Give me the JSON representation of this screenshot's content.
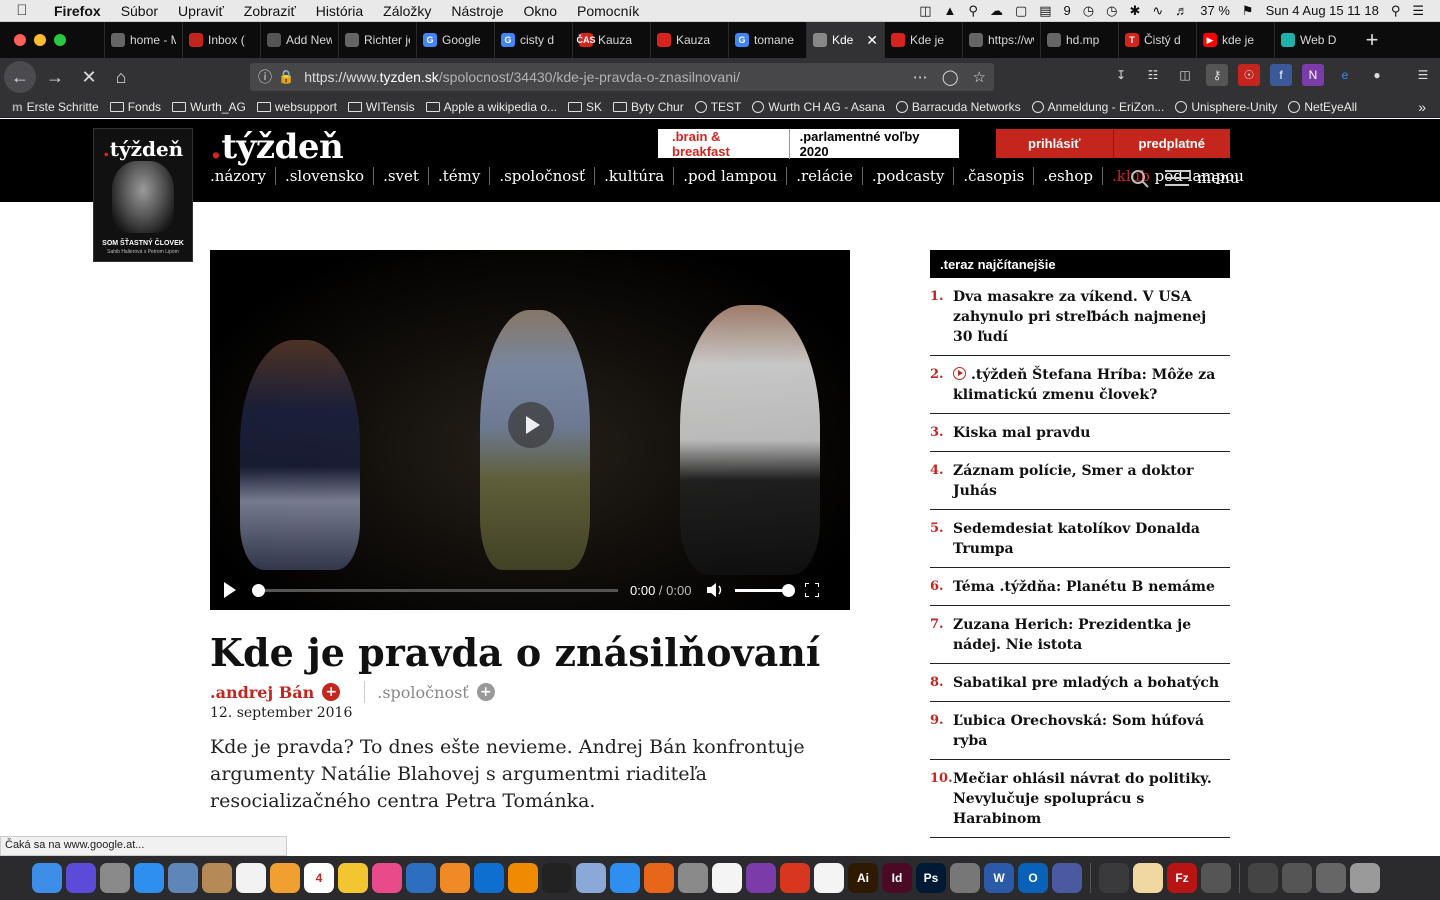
{
  "menubar": {
    "app": "Firefox",
    "items": [
      "Súbor",
      "Upraviť",
      "Zobraziť",
      "História",
      "Záložky",
      "Nástroje",
      "Okno",
      "Pomocník"
    ],
    "status": {
      "count": "9",
      "battery": "37 %",
      "datetime": "Sun 4 Aug  15 11 18"
    }
  },
  "tabs": [
    {
      "label": "home - Ma",
      "favicon_color": "#666666",
      "favicon_text": ""
    },
    {
      "label": "Inbox (",
      "favicon_color": "#c4261d",
      "favicon_text": ""
    },
    {
      "label": "Add New P",
      "favicon_color": "#555555",
      "favicon_text": ""
    },
    {
      "label": "Richter je z",
      "favicon_color": "#666666",
      "favicon_text": ""
    },
    {
      "label": "Google",
      "favicon_color": "#4285f4",
      "favicon_text": "G"
    },
    {
      "label": "cisty d",
      "favicon_color": "#4285f4",
      "favicon_text": "G"
    },
    {
      "label": "Kauza",
      "favicon_color": "#d7231e",
      "favicon_text": "ČAS"
    },
    {
      "label": "Kauza",
      "favicon_color": "#d7231e",
      "favicon_text": ""
    },
    {
      "label": "tomane",
      "favicon_color": "#4285f4",
      "favicon_text": "G"
    },
    {
      "label": "Kde",
      "favicon_color": "#888888",
      "favicon_text": "",
      "active": true
    },
    {
      "label": "Kde je",
      "favicon_color": "#d7231e",
      "favicon_text": ""
    },
    {
      "label": "https://ww",
      "favicon_color": "#666666",
      "favicon_text": ""
    },
    {
      "label": "hd.mp",
      "favicon_color": "#666666",
      "favicon_text": ""
    },
    {
      "label": "Čistý d",
      "favicon_color": "#d7231e",
      "favicon_text": "T"
    },
    {
      "label": "kde je",
      "favicon_color": "#ff0000",
      "favicon_text": "▶"
    },
    {
      "label": "Web D",
      "favicon_color": "#20b2aa",
      "favicon_text": ""
    }
  ],
  "urlbar": {
    "scheme": "https://www.",
    "host": "tyzden.sk",
    "path": "/spolocnost/34430/kde-je-pravda-o-znasilnovani/"
  },
  "bookmarks": [
    {
      "label": "Erste Schritte",
      "type": "m"
    },
    {
      "label": "Fonds",
      "type": "folder"
    },
    {
      "label": "Wurth_AG",
      "type": "folder"
    },
    {
      "label": "websupport",
      "type": "folder"
    },
    {
      "label": "WITensis",
      "type": "folder"
    },
    {
      "label": "Apple a wikipedia o...",
      "type": "folder"
    },
    {
      "label": "SK",
      "type": "folder"
    },
    {
      "label": "Byty Chur",
      "type": "folder"
    },
    {
      "label": "TEST",
      "type": "globe"
    },
    {
      "label": "Wurth CH AG - Asana",
      "type": "globe"
    },
    {
      "label": "Barracuda Networks",
      "type": "globe"
    },
    {
      "label": "Anmeldung - EriZon...",
      "type": "globe"
    },
    {
      "label": "Unisphere-Unity",
      "type": "globe"
    },
    {
      "label": "NetEyeAll",
      "type": "globe"
    }
  ],
  "site": {
    "logo_dot": ".",
    "logo_text": "týždeň",
    "nav": [
      ".názory",
      ".slovensko",
      ".svet",
      ".témy",
      ".spoločnosť",
      ".kultúra",
      ".pod lampou",
      ".relácie",
      ".podcasty",
      ".časopis",
      ".eshop"
    ],
    "nav_klub_red": ".klub",
    "nav_klub_rest": " pod lampou",
    "promo_1": ".brain & breakfast",
    "promo_2": ".parlamentné voľby 2020",
    "login": "prihlásiť",
    "subscribe": "predplatné",
    "menu": "menu"
  },
  "cover": {
    "title_dot": ".",
    "title": "týždeň",
    "caption": "SOM ŠŤASTNÝ ČLOVEK",
    "subcaption": "Sahib Hallerová s Petrom Lipom"
  },
  "video": {
    "time_current": "0:00",
    "time_sep": " / ",
    "time_total": "0:00",
    "progress": 0,
    "volume": 1.0
  },
  "article": {
    "title": "Kde je pravda o znásilňovaní",
    "author": ".andrej Bán",
    "section": ".spoločnosť",
    "date": "12. september 2016",
    "perex": "Kde je pravda? To dnes ešte nevieme. Andrej Bán konfrontuje argumenty Natálie Blahovej s argumentmi riaditeľa resocializačného centra Petra Tománka."
  },
  "most_read": {
    "header": ".teraz najčítanejšie",
    "items": [
      {
        "num": "1.",
        "title": "Dva masakre za víkend. V USA zahynulo pri streľbách najmenej 30 ľudí",
        "video": false
      },
      {
        "num": "2.",
        "title": ".týždeň Štefana Hríba: Môže za klimatickú zmenu človek?",
        "video": true
      },
      {
        "num": "3.",
        "title": "Kiska mal pravdu",
        "video": false
      },
      {
        "num": "4.",
        "title": "Záznam polície, Smer a doktor Juhás",
        "video": false
      },
      {
        "num": "5.",
        "title": "Sedemdesiat katolíkov Donalda Trumpa",
        "video": false
      },
      {
        "num": "6.",
        "title": "Téma .týždňa: Planétu B nemáme",
        "video": false
      },
      {
        "num": "7.",
        "title": "Zuzana Herich: Prezidentka je nádej. Nie istota",
        "video": false
      },
      {
        "num": "8.",
        "title": "Sabatikal pre mladých a bohatých",
        "video": false
      },
      {
        "num": "9.",
        "title": "Ľubica Orechovská: Som húfová ryba",
        "video": false
      },
      {
        "num": "10.",
        "title": "Mečiar ohlásil návrat do politiky. Nevylučuje spoluprácu s Harabinom",
        "video": false
      }
    ]
  },
  "status_text": "Čaká sa na www.google.at...",
  "dock": [
    {
      "name": "finder-icon",
      "color": "#3d8ee8"
    },
    {
      "name": "siri-icon",
      "color": "#5b4bd8"
    },
    {
      "name": "launchpad-icon",
      "color": "#8a8a8a"
    },
    {
      "name": "safari-icon",
      "color": "#2f8ff0"
    },
    {
      "name": "preview-icon",
      "color": "#5e86b8"
    },
    {
      "name": "contacts-icon",
      "color": "#b58a56"
    },
    {
      "name": "notes-icon",
      "color": "#f2f2f2"
    },
    {
      "name": "photos-icon",
      "color": "#f0a030"
    },
    {
      "name": "calendar-icon",
      "color": "#ffffff",
      "text": "4"
    },
    {
      "name": "norton-icon",
      "color": "#f2c531"
    },
    {
      "name": "itunes-icon",
      "color": "#e84a8a"
    },
    {
      "name": "xcode-icon",
      "color": "#2c6ec0"
    },
    {
      "name": "books-icon",
      "color": "#f08a24"
    },
    {
      "name": "teamviewer-icon",
      "color": "#0e6fd1"
    },
    {
      "name": "vlc-icon",
      "color": "#f08a00"
    },
    {
      "name": "terminal-icon",
      "color": "#222222"
    },
    {
      "name": "virtualbox-icon",
      "color": "#8aa8d8"
    },
    {
      "name": "appstore-icon",
      "color": "#2f8ff0"
    },
    {
      "name": "firefox-icon",
      "color": "#e8661a"
    },
    {
      "name": "system-preferences-icon",
      "color": "#8a8a8a"
    },
    {
      "name": "acrobat-icon",
      "color": "#f4f4f4"
    },
    {
      "name": "onenote-icon",
      "color": "#7b3ba8"
    },
    {
      "name": "citrix-icon",
      "color": "#d8361e"
    },
    {
      "name": "pdf-icon",
      "color": "#f4f4f4"
    },
    {
      "name": "illustrator-icon",
      "color": "#2e1a00",
      "text": "Ai"
    },
    {
      "name": "indesign-icon",
      "color": "#4a0a26",
      "text": "Id"
    },
    {
      "name": "photoshop-icon",
      "color": "#001a35",
      "text": "Ps"
    },
    {
      "name": "utility-icon",
      "color": "#777777"
    },
    {
      "name": "word-icon",
      "color": "#2b5aa8",
      "text": "W"
    },
    {
      "name": "outlook-icon",
      "color": "#0a62b8",
      "text": "O"
    },
    {
      "name": "grid-app-icon",
      "color": "#4a5aa0"
    },
    {
      "name": "gear-icon",
      "color": "#3a3a3c"
    },
    {
      "name": "textedit-icon",
      "color": "#f0d8a0"
    },
    {
      "name": "filezilla-icon",
      "color": "#b81414",
      "text": "Fz"
    },
    {
      "name": "sync-icon",
      "color": "#555555"
    },
    {
      "name": "screen-thumb-icon",
      "color": "#444444"
    },
    {
      "name": "screen-thumb-icon-2",
      "color": "#555555"
    },
    {
      "name": "screen-thumb-icon-3",
      "color": "#666666"
    },
    {
      "name": "trash-icon",
      "color": "#9a9a9a"
    }
  ],
  "colors": {
    "brand_red": "#c4261d",
    "header_bg": "#000000",
    "tabbar_bg": "#0c0c0d"
  }
}
